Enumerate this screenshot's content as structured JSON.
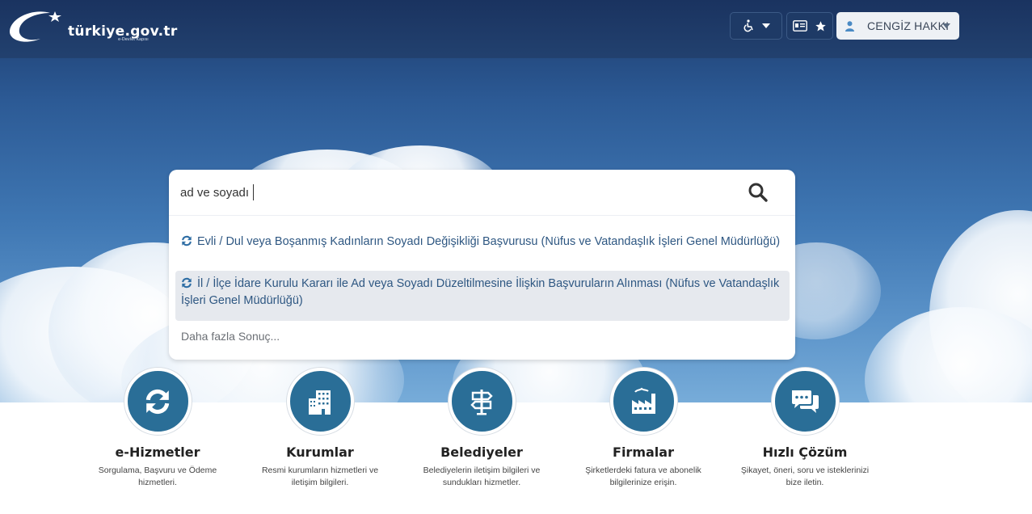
{
  "header": {
    "logo_text": "türkiye.gov.tr",
    "logo_sub": "e-Devlet Kapısı",
    "accessibility_icon": "wheelchair-icon",
    "card_icon": "id-card-icon",
    "favorites_icon": "star-icon",
    "user_icon": "user-icon",
    "user_name": "CENGİZ HAKKI"
  },
  "search": {
    "value": "ad ve soyadı",
    "search_icon": "search-icon",
    "results": [
      {
        "icon": "refresh-icon",
        "text": "Evli / Dul veya Boşanmış Kadınların Soyadı Değişikliği Başvurusu (Nüfus ve Vatandaşlık İşleri Genel Müdürlüğü)"
      },
      {
        "icon": "refresh-icon",
        "text": "İl / İlçe İdare Kurulu Kararı ile Ad veya Soyadı Düzeltilmesine İlişkin Başvuruların Alınması (Nüfus ve Vatandaşlık İşleri Genel Müdürlüğü)"
      }
    ],
    "more_label": "Daha fazla Sonuç..."
  },
  "features": [
    {
      "icon": "refresh-icon",
      "title": "e-Hizmetler",
      "desc": "Sorgulama, Başvuru ve Ödeme hizmetleri."
    },
    {
      "icon": "building-icon",
      "title": "Kurumlar",
      "desc": "Resmi kurumların hizmetleri ve iletişim bilgileri."
    },
    {
      "icon": "signpost-icon",
      "title": "Belediyeler",
      "desc": "Belediyelerin iletişim bilgileri ve sundukları hizmetler."
    },
    {
      "icon": "factory-icon",
      "title": "Firmalar",
      "desc": "Şirketlerdeki fatura ve abonelik bilgilerinize erişin."
    },
    {
      "icon": "chat-icon",
      "title": "Hızlı Çözüm",
      "desc": "Şikayet, öneri, soru ve isteklerinizi bize iletin."
    }
  ],
  "colors": {
    "header_bg": "#1a3360",
    "feature_circle": "#2a6e97",
    "result_link": "#2e5782",
    "highlight_row": "#e6e9ee"
  }
}
